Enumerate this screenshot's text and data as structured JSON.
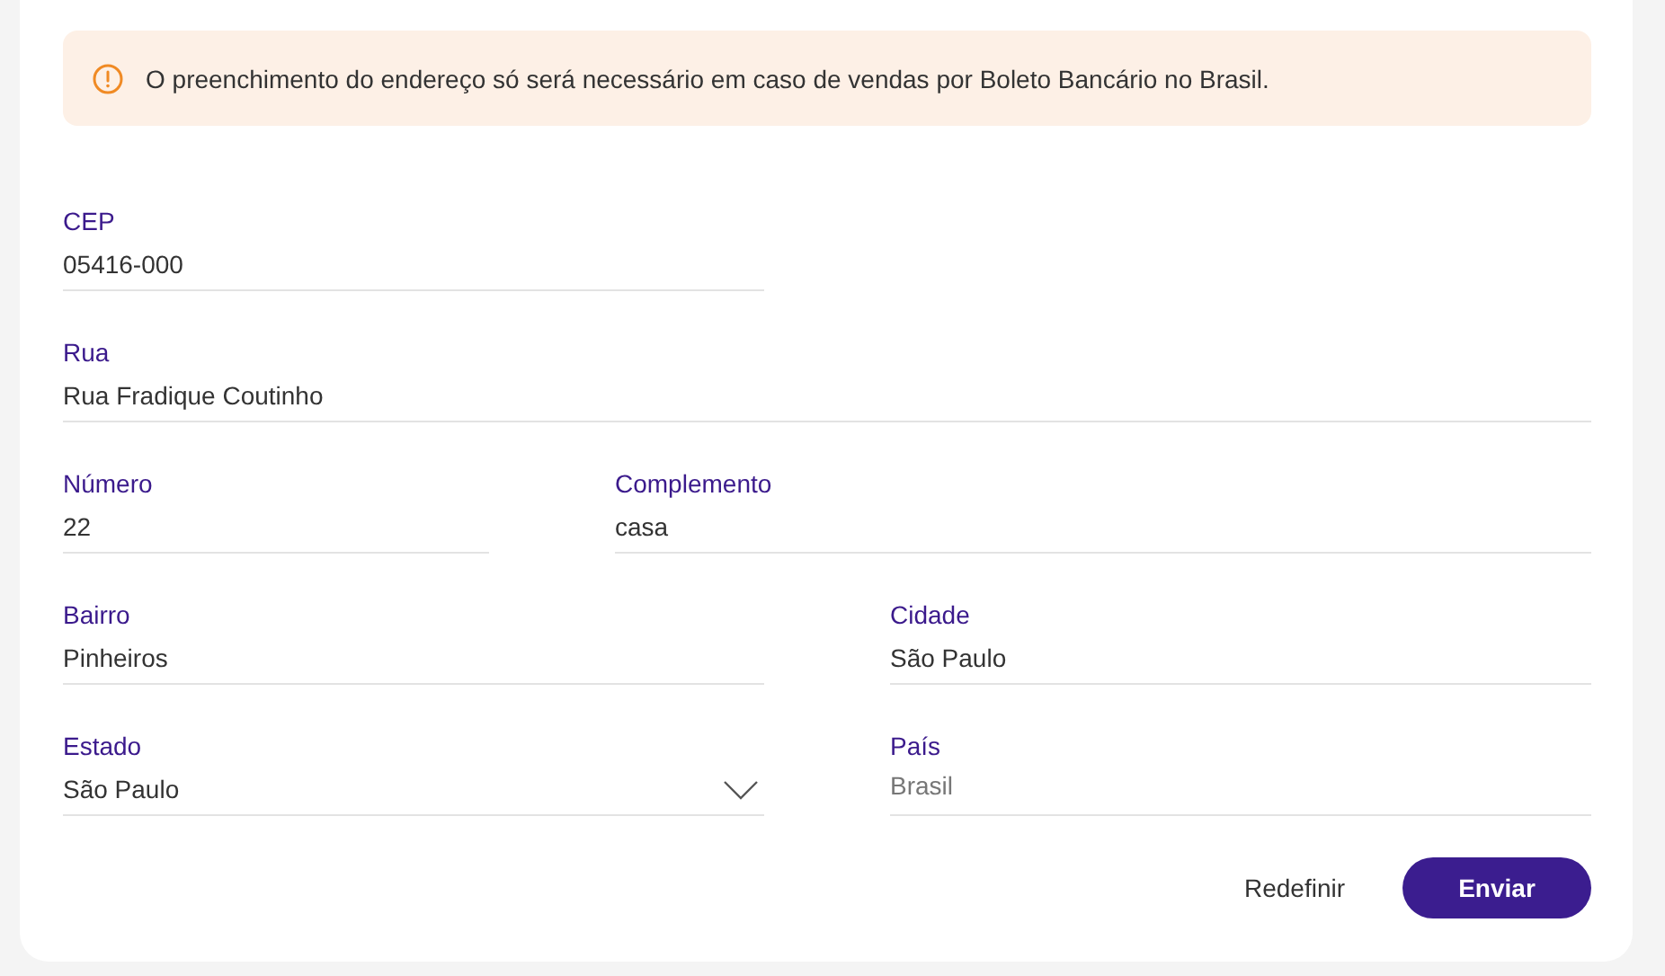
{
  "alert": {
    "text": "O preenchimento do endereço só será necessário em caso de vendas por Boleto Bancário no Brasil."
  },
  "rows": [
    [
      {
        "label": "CEP",
        "value": "05416-000",
        "kind": "text",
        "disabled": false
      }
    ],
    [
      {
        "label": "Rua",
        "value": "Rua Fradique Coutinho",
        "kind": "text",
        "disabled": false
      }
    ],
    [
      {
        "label": "Número",
        "value": "22",
        "kind": "text",
        "disabled": false
      },
      {
        "label": "Complemento",
        "value": "casa",
        "kind": "text",
        "disabled": false
      }
    ],
    [
      {
        "label": "Bairro",
        "value": "Pinheiros",
        "kind": "text",
        "disabled": false
      },
      {
        "label": "Cidade",
        "value": "São Paulo",
        "kind": "text",
        "disabled": false
      }
    ],
    [
      {
        "label": "Estado",
        "value": "São Paulo",
        "kind": "select",
        "disabled": false
      },
      {
        "label": "País",
        "value": "Brasil",
        "kind": "text",
        "disabled": true
      }
    ]
  ],
  "buttons": {
    "reset": "Redefinir",
    "submit": "Enviar"
  }
}
